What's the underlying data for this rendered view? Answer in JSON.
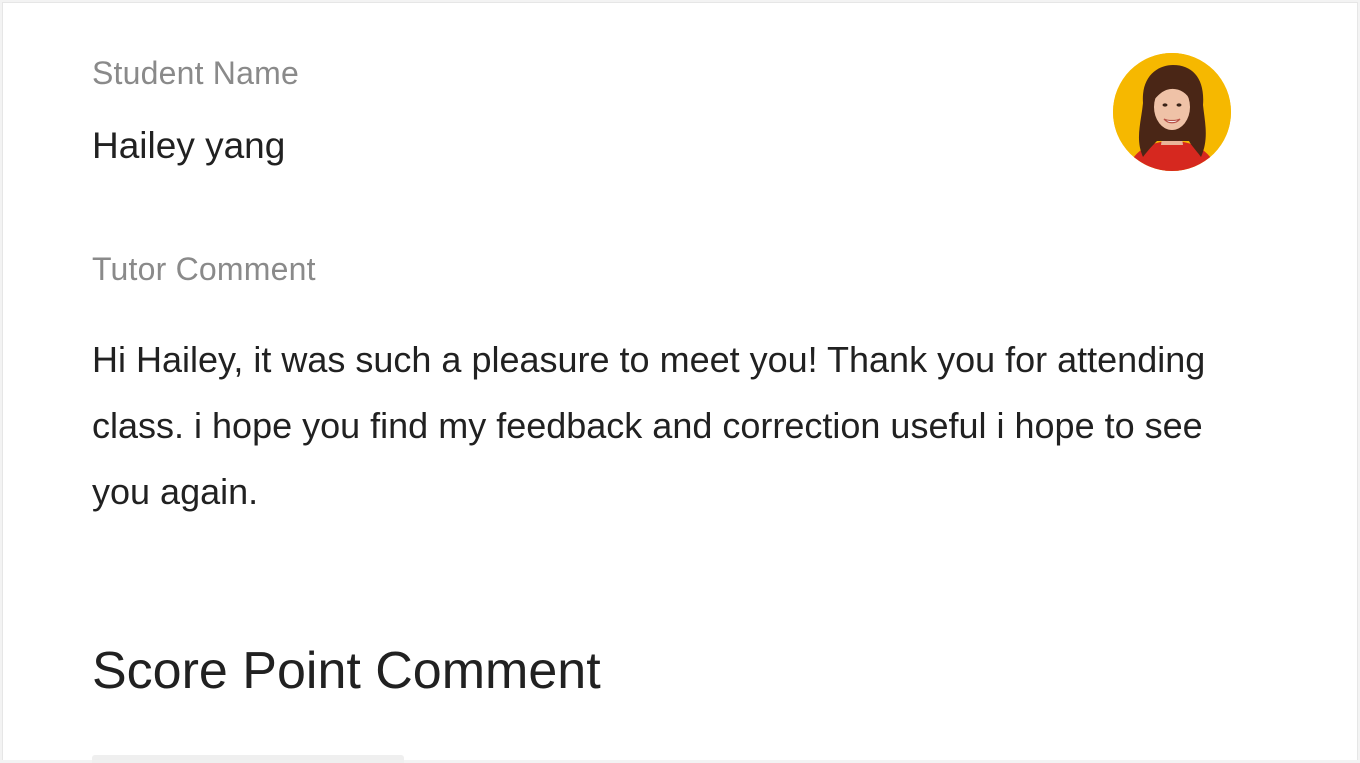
{
  "student": {
    "label": "Student Name",
    "name": "Hailey yang"
  },
  "tutor": {
    "label": "Tutor Comment",
    "comment": "Hi Hailey, it was such a pleasure to meet you! Thank you for attending class. i hope you find my feedback and correction useful i hope to see you again."
  },
  "score": {
    "title": "Score Point Comment"
  },
  "avatar": {
    "icon": "student-photo",
    "background_color": "#f6b800"
  }
}
